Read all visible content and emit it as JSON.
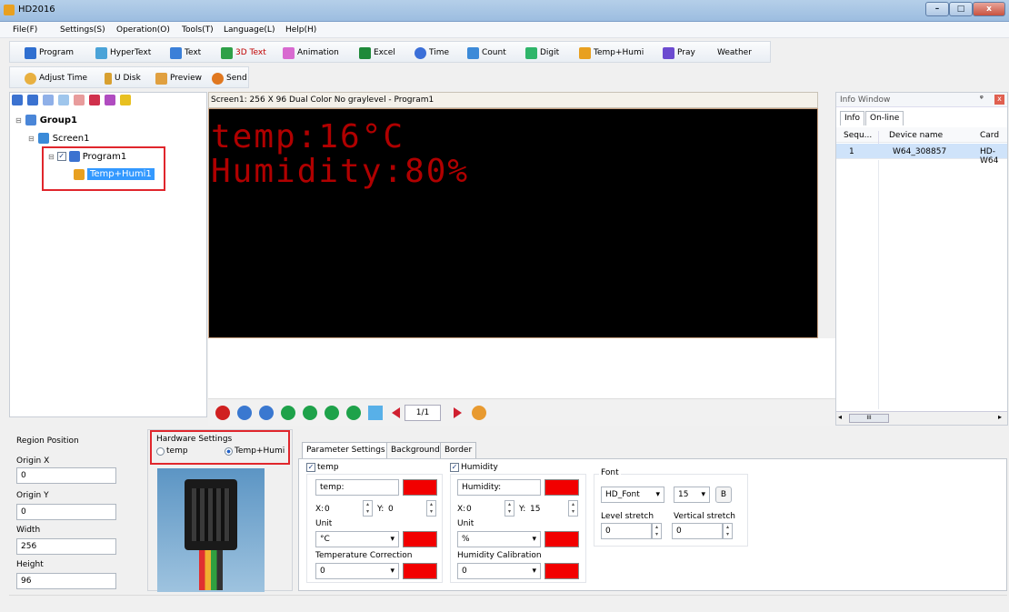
{
  "window": {
    "title": "HD2016",
    "min": "–",
    "max": "□",
    "close": "x"
  },
  "menu": [
    "File(F)",
    "Settings(S)",
    "Operation(O)",
    "Tools(T)",
    "Language(L)",
    "Help(H)"
  ],
  "toolbar1": [
    "Program",
    "HyperText",
    "Text",
    "3D Text",
    "Animation",
    "Excel",
    "Time",
    "Count",
    "Digit",
    "Temp+Humi",
    "Pray",
    "Weather"
  ],
  "toolbar2": [
    "Adjust Time",
    "U Disk",
    "Preview",
    "Send"
  ],
  "tree": {
    "group": "Group1",
    "screen": "Screen1",
    "program": "Program1",
    "item": "Temp+Humi1"
  },
  "preview": {
    "header": "Screen1: 256 X 96  Dual Color No graylevel - Program1",
    "line1": "temp:16°C",
    "line2": "Humidity:80%",
    "page": "1/1"
  },
  "info": {
    "title": "Info Window",
    "pin": "ᵠ",
    "close": "x",
    "tab_info": "Info",
    "tab_online": "On-line",
    "col_seq": "Sequ...",
    "col_device": "Device name",
    "col_card": "Card",
    "row": {
      "seq": "1",
      "device": "W64_308857",
      "card": "HD-W64"
    },
    "scroll_mark": "III"
  },
  "region": {
    "title": "Region Position",
    "origin_x_label": "Origin X",
    "origin_x": "0",
    "origin_y_label": "Origin Y",
    "origin_y": "0",
    "width_label": "Width",
    "width": "256",
    "height_label": "Height",
    "height": "96"
  },
  "hardware": {
    "title": "Hardware Settings",
    "opt_temp": "temp",
    "opt_temphumi": "Temp+Humi"
  },
  "params": {
    "tabs": [
      "Parameter Settings",
      "Background",
      "Border"
    ],
    "temp": {
      "check_label": "temp",
      "text": "temp:",
      "x_label": "X:",
      "x": "0",
      "y_label": "Y:",
      "y": "0",
      "unit_label": "Unit",
      "unit": "°C",
      "corr_label": "Temperature Correction",
      "corr": "0"
    },
    "humidity": {
      "check_label": "Humidity",
      "text": "Humidity:",
      "x_label": "X:",
      "x": "0",
      "y_label": "Y:",
      "y": "15",
      "unit_label": "Unit",
      "unit": "%",
      "calib_label": "Humidity Calibration",
      "calib": "0"
    },
    "font": {
      "title": "Font",
      "name": "HD_Font",
      "size": "15",
      "bold": "B",
      "level_label": "Level stretch",
      "level": "0",
      "vertical_label": "Vertical stretch",
      "vertical": "0"
    }
  },
  "colors": {
    "led": "#b00000",
    "swatch": "#f20000",
    "highlight": "#e0262c",
    "selection": "#3399ff"
  }
}
